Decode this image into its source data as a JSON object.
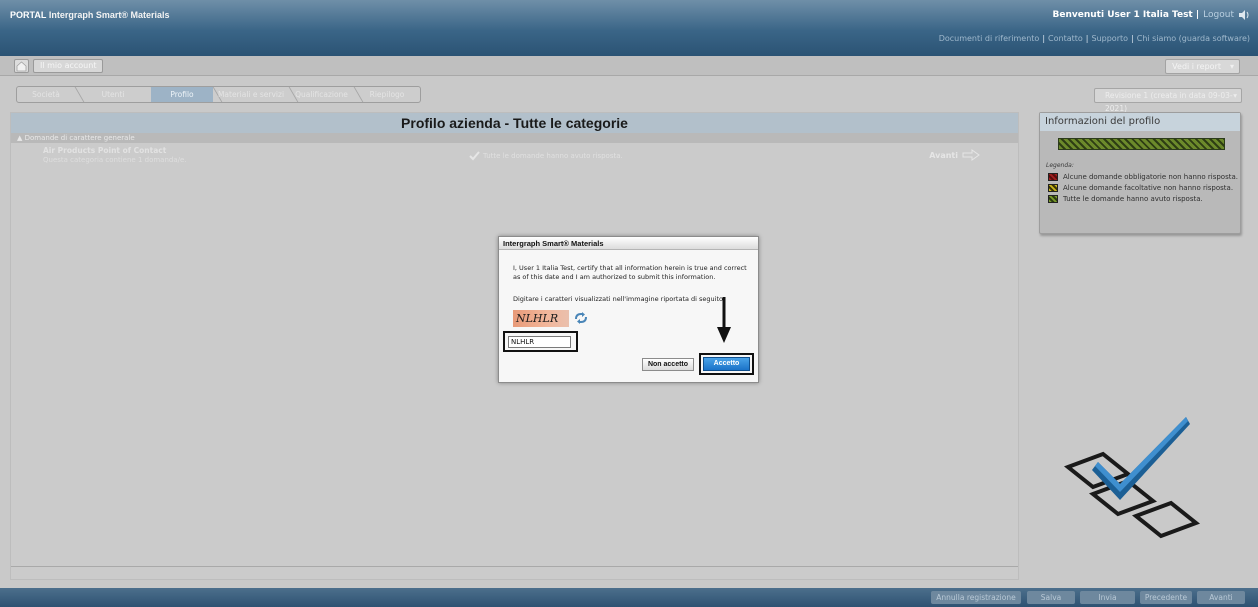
{
  "header": {
    "portal_label": "PORTAL",
    "app_name": "Intergraph Smart® Materials",
    "welcome": "Benvenuti User 1 Italia Test |",
    "logout": "Logout",
    "links": [
      "Documenti di riferimento",
      "Contatto",
      "Supporto",
      "Chi siamo (guarda software)"
    ]
  },
  "toolbar": {
    "account": "Il mio account",
    "reports": "Vedi i report"
  },
  "wizard": {
    "steps": [
      "Società",
      "Utenti",
      "Profilo",
      "Materiali e servizi",
      "Qualificazione",
      "Riepilogo"
    ],
    "active_index": 2
  },
  "revision": "Revisione 1 (creata in data 09-03-2021)",
  "main": {
    "title": "Profilo azienda - Tutte le categorie",
    "section": "Domande di carattere generale",
    "question_title": "Air Products Point of Contact",
    "question_sub": "Questa categoria contiene 1 domanda/e.",
    "question_status": "Tutte le domande hanno avuto risposta.",
    "next": "Avanti"
  },
  "info_panel": {
    "title": "Informazioni del profilo",
    "legend_title": "Legenda:",
    "legend": [
      {
        "color": "#a11f1f",
        "text": "Alcune domande obbligatorie non hanno risposta."
      },
      {
        "color": "#c9b51a",
        "text": "Alcune domande facoltative non hanno risposta."
      },
      {
        "color": "#7a9b2a",
        "text": "Tutte le domande hanno avuto risposta."
      }
    ]
  },
  "bottom_buttons": [
    "Annulla registrazione",
    "Salva",
    "Invia",
    "Precedente",
    "Avanti"
  ],
  "dialog": {
    "title": "Intergraph Smart® Materials",
    "certify_text": "I, User 1 Italia Test, certify that all information herein is true and correct as of this date and I am authorized to submit this information.",
    "captcha_prompt": "Digitare i caratteri visualizzati nell'immagine riportata di seguito.",
    "captcha_text": "NLHLR",
    "captcha_input_value": "NLHLR",
    "decline_label": "Non accetto",
    "accept_label": "Accetto"
  },
  "colors": {
    "accent": "#1b73c8",
    "header": "#3a6587",
    "complete": "#7a9b2a"
  }
}
